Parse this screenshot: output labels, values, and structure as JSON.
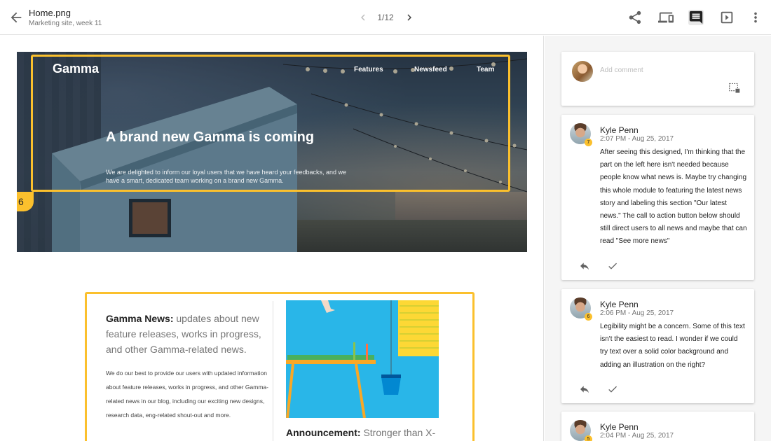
{
  "header": {
    "file_name": "Home.png",
    "file_subtitle": "Marketing site, week 11",
    "pager": "1/12",
    "icons": [
      "arrow-back-icon",
      "chevron-left-icon",
      "chevron-right-icon",
      "share-icon",
      "devices-icon",
      "comment-icon",
      "slideshow-icon",
      "more-vert-icon"
    ]
  },
  "hero": {
    "logo": "Gamma",
    "nav": [
      "Features",
      "Newsfeed",
      "Team"
    ],
    "title": "A brand new Gamma is coming",
    "body": "We are delighted to inform our loyal users that we have heard your feedbacks, and we have a smart, dedicated team working on a brand new Gamma.",
    "pin_number": "6"
  },
  "news": {
    "title_bold": "Gamma News:",
    "title_rest": " updates about new feature releases, works in progress, and other Gamma-related news.",
    "description": "We do our best to provide our users with updated information about feature releases, works in progress, and other Gamma-related news in our blog, including our exciting new designs, research data, eng-related shout-out and more.",
    "announce_bold": "Announcement:",
    "announce_rest": " Stronger than X-"
  },
  "sidebar": {
    "add_comment_placeholder": "Add comment",
    "comments": [
      {
        "author": "Kyle Penn",
        "time": "2:07 PM - Aug 25, 2017",
        "badge": "7",
        "text": "After seeing this designed, I'm thinking that the part on the left here isn't needed because people know what news is. Maybe try changing this whole module to featuring the latest news story and labeling this section \"Our latest news.\" The call to action button below should still direct users to all news and maybe that can read \"See more news\""
      },
      {
        "author": "Kyle Penn",
        "time": "2:06 PM - Aug 25, 2017",
        "badge": "6",
        "text": "Legibility might be a concern. Some of this text isn't the easiest to read. I wonder if we could try text over a solid color background and adding an illustration on the right?"
      },
      {
        "author": "Kyle Penn",
        "time": "2:04 PM - Aug 25, 2017",
        "badge": "5",
        "text": ""
      }
    ]
  },
  "colors": {
    "highlight": "#fbc02d",
    "illustration_bg": "#29b6e8"
  }
}
